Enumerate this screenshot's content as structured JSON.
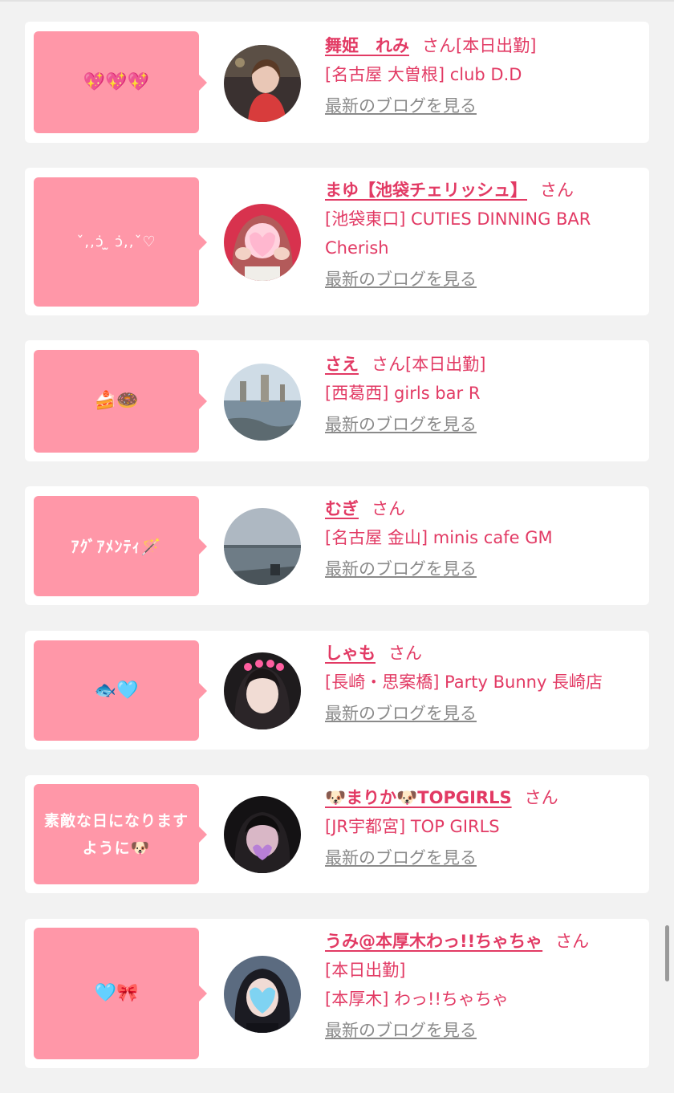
{
  "colors": {
    "accent": "#e23a64",
    "bubble": "#ff97a8",
    "link_gray": "#8a8a8a"
  },
  "blog_link_label": "最新のブログを見る",
  "entries": [
    {
      "bubble": "💖💖💖",
      "name": "舞姫　れみ",
      "suffix": "さん",
      "status": "[本日出勤]",
      "shop": "[名古屋 大曽根] club D.D"
    },
    {
      "bubble": "ˇ,,ↄ̇ ̫ ↄ̇,,ˇ♡",
      "name": "まゆ【池袋チェリッシュ】",
      "suffix": "さん",
      "status": "",
      "shop": "[池袋東口] CUTIES DINNING BAR Cherish"
    },
    {
      "bubble": "🍰🍩",
      "name": "さえ",
      "suffix": "さん",
      "status": "[本日出勤]",
      "shop": "[西葛西] girls bar R"
    },
    {
      "bubble": "ｱｸﾞｱﾒﾝﾃｨ🪄",
      "name": "むぎ",
      "suffix": "さん",
      "status": "",
      "shop": "[名古屋 金山] minis cafe GM"
    },
    {
      "bubble": "🐟🩵",
      "name": "しゃも",
      "suffix": "さん",
      "status": "",
      "shop": "[長崎・思案橋] Party Bunny 長崎店"
    },
    {
      "bubble": "素敵な日になりますように🐶",
      "name": "🐶まりか🐶TOPGIRLS",
      "suffix": "さん",
      "status": "",
      "shop": "[JR宇都宮] TOP GIRLS"
    },
    {
      "bubble": "🩵🎀",
      "name": "うみ@本厚木わっ!!ちゃちゃ",
      "suffix": "さん",
      "status": "[本日出勤]",
      "shop": "[本厚木] わっ!!ちゃちゃ"
    }
  ]
}
